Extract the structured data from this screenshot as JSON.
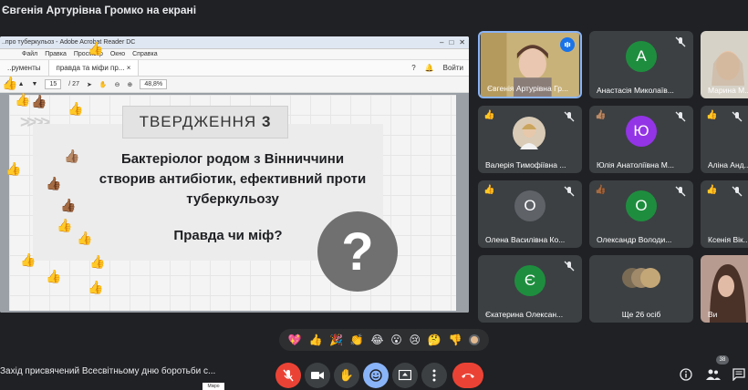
{
  "presenter_banner": "Євгенія Артурівна Громко на екрані",
  "shared_screen": {
    "window_title": "..про туберкульоз - Adobe Acrobat Reader DC",
    "menu": [
      "Файл",
      "Правка",
      "Просмотр",
      "Окно",
      "Справка"
    ],
    "tabs": [
      "..рументы",
      "правда та міфи пр..."
    ],
    "signin": "Войти",
    "toolbar": {
      "page": "15",
      "total": "/ 27",
      "zoom": "48,8%"
    },
    "slide": {
      "statement": "ТВЕРДЖЕННЯ",
      "statement_number": "3",
      "line1": "Бактеріолог родом з Вінниччини",
      "line2": "створив антибіотик, ефективний проти",
      "line3": "туберкульозу",
      "question": "Правда чи міф?",
      "qmark": "?"
    }
  },
  "participants": [
    {
      "name": "Євгенія Артурівна Гр...",
      "type": "video",
      "mic": "speaking"
    },
    {
      "name": "Анастасія Миколаїв...",
      "initial": "А",
      "color": "#1e8e3e",
      "mic": "off"
    },
    {
      "name": "Марина М...",
      "type": "video",
      "mic": "off"
    },
    {
      "name": "Валерія Тимофіївна ...",
      "type": "photo",
      "mic": "off",
      "hand": true
    },
    {
      "name": "Юлія Анатоліївна М...",
      "initial": "Ю",
      "color": "#9334e6",
      "mic": "off",
      "hand": true
    },
    {
      "name": "Аліна Анд...",
      "initial": "",
      "color": "#3c4043",
      "mic": "off",
      "hand": true
    },
    {
      "name": "Олена Василівна Ко...",
      "initial": "О",
      "color": "#5f6368",
      "mic": "off",
      "hand": true
    },
    {
      "name": "Олександр Володи...",
      "initial": "О",
      "color": "#1e8e3e",
      "mic": "off",
      "hand": true
    },
    {
      "name": "Ксенія Вік...",
      "initial": "",
      "color": "#3c4043",
      "mic": "off",
      "hand": true
    },
    {
      "name": "Єкатерина Олексан...",
      "initial": "Є",
      "color": "#1e8e3e",
      "mic": "off"
    },
    {
      "name": "Ще 26 осіб",
      "type": "more"
    },
    {
      "name": "Ви",
      "type": "video"
    }
  ],
  "reactions": [
    "💖",
    "👍",
    "🎉",
    "👏",
    "😂",
    "😮",
    "😢",
    "🤔",
    "👎"
  ],
  "meeting_title": "Захід присвячений Всесвітньому дню боротьби с...",
  "tooltip": "Мікро",
  "people_count": "38",
  "colors": {
    "background": "#202124",
    "tile": "#3c4043",
    "end_call": "#ea4335",
    "accent": "#8ab4f8"
  }
}
